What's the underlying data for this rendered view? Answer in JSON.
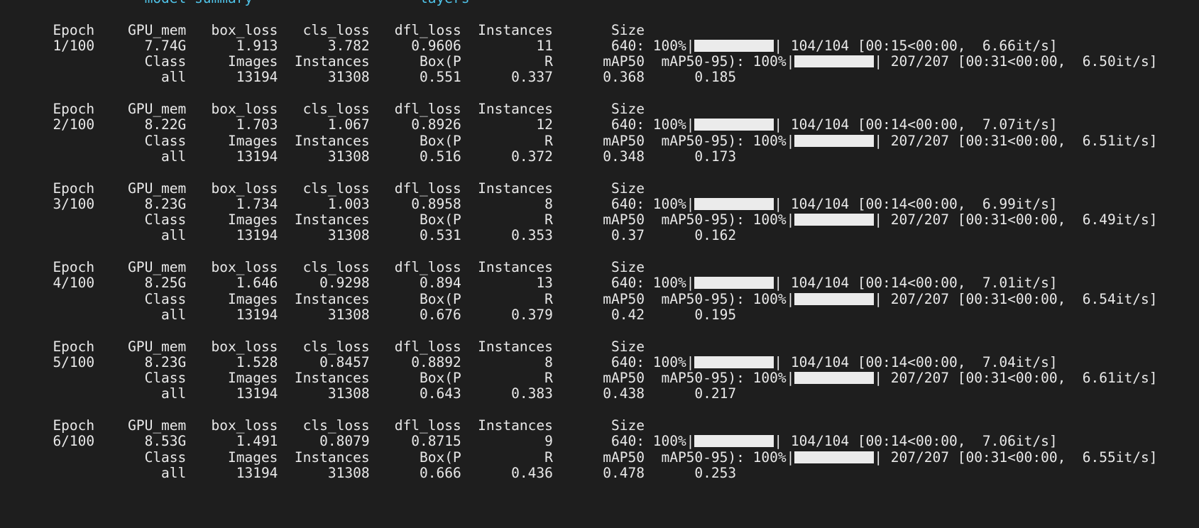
{
  "terminal": {
    "background_color": "#1e1e1e",
    "foreground_color": "#e6e6e6",
    "accent_cyan": "#4fc3e8",
    "bar_color": "#ebebeb",
    "total_epochs": "100",
    "partial_top_line": "                 model summary                    layers",
    "headers": {
      "train": "      Epoch    GPU_mem   box_loss   cls_loss   dfl_loss  Instances       Size",
      "val": "                 Class     Images  Instances      Box(P          R      mAP50  mAP50-95): "
    },
    "train_columns": [
      "Epoch",
      "GPU_mem",
      "box_loss",
      "cls_loss",
      "dfl_loss",
      "Instances",
      "Size"
    ],
    "val_columns": [
      "Class",
      "Images",
      "Instances",
      "Box(P",
      "R",
      "mAP50",
      "mAP50-95):"
    ],
    "progress": {
      "train_percent": "100%",
      "train_count": "104/104",
      "val_percent": "100%",
      "val_count": "207/207",
      "pipe": "|"
    },
    "epochs": [
      {
        "epoch": "1/100",
        "gpu_mem": "7.74G",
        "box_loss": "1.913",
        "cls_loss": "3.782",
        "dfl_loss": "0.9606",
        "instances": "11",
        "size": "640:",
        "train_percent": "100%",
        "train_count": "104/104",
        "train_elapsed": "00:15",
        "train_remaining": "00:00",
        "train_rate": "6.66it/s",
        "train_bracket": "[00:15<00:00,  6.66it/s]",
        "val_class": "all",
        "val_images": "13194",
        "val_instances": "31308",
        "box_p": "0.551",
        "recall": "0.337",
        "map50": "0.368",
        "map50_95": "0.185",
        "val_percent": "100%",
        "val_count": "207/207",
        "val_elapsed": "00:31",
        "val_remaining": "00:00",
        "val_rate": "6.50it/s",
        "val_bracket": "[00:31<00:00,  6.50it/s]"
      },
      {
        "epoch": "2/100",
        "gpu_mem": "8.22G",
        "box_loss": "1.703",
        "cls_loss": "1.067",
        "dfl_loss": "0.8926",
        "instances": "12",
        "size": "640:",
        "train_percent": "100%",
        "train_count": "104/104",
        "train_elapsed": "00:14",
        "train_remaining": "00:00",
        "train_rate": "7.07it/s",
        "train_bracket": "[00:14<00:00,  7.07it/s]",
        "val_class": "all",
        "val_images": "13194",
        "val_instances": "31308",
        "box_p": "0.516",
        "recall": "0.372",
        "map50": "0.348",
        "map50_95": "0.173",
        "val_percent": "100%",
        "val_count": "207/207",
        "val_elapsed": "00:31",
        "val_remaining": "00:00",
        "val_rate": "6.51it/s",
        "val_bracket": "[00:31<00:00,  6.51it/s]"
      },
      {
        "epoch": "3/100",
        "gpu_mem": "8.23G",
        "box_loss": "1.734",
        "cls_loss": "1.003",
        "dfl_loss": "0.8958",
        "instances": "8",
        "size": "640:",
        "train_percent": "100%",
        "train_count": "104/104",
        "train_elapsed": "00:14",
        "train_remaining": "00:00",
        "train_rate": "6.99it/s",
        "train_bracket": "[00:14<00:00,  6.99it/s]",
        "val_class": "all",
        "val_images": "13194",
        "val_instances": "31308",
        "box_p": "0.531",
        "recall": "0.353",
        "map50": "0.37",
        "map50_95": "0.162",
        "val_percent": "100%",
        "val_count": "207/207",
        "val_elapsed": "00:31",
        "val_remaining": "00:00",
        "val_rate": "6.49it/s",
        "val_bracket": "[00:31<00:00,  6.49it/s]"
      },
      {
        "epoch": "4/100",
        "gpu_mem": "8.25G",
        "box_loss": "1.646",
        "cls_loss": "0.9298",
        "dfl_loss": "0.894",
        "instances": "13",
        "size": "640:",
        "train_percent": "100%",
        "train_count": "104/104",
        "train_elapsed": "00:14",
        "train_remaining": "00:00",
        "train_rate": "7.01it/s",
        "train_bracket": "[00:14<00:00,  7.01it/s]",
        "val_class": "all",
        "val_images": "13194",
        "val_instances": "31308",
        "box_p": "0.676",
        "recall": "0.379",
        "map50": "0.42",
        "map50_95": "0.195",
        "val_percent": "100%",
        "val_count": "207/207",
        "val_elapsed": "00:31",
        "val_remaining": "00:00",
        "val_rate": "6.54it/s",
        "val_bracket": "[00:31<00:00,  6.54it/s]"
      },
      {
        "epoch": "5/100",
        "gpu_mem": "8.23G",
        "box_loss": "1.528",
        "cls_loss": "0.8457",
        "dfl_loss": "0.8892",
        "instances": "8",
        "size": "640:",
        "train_percent": "100%",
        "train_count": "104/104",
        "train_elapsed": "00:14",
        "train_remaining": "00:00",
        "train_rate": "7.04it/s",
        "train_bracket": "[00:14<00:00,  7.04it/s]",
        "val_class": "all",
        "val_images": "13194",
        "val_instances": "31308",
        "box_p": "0.643",
        "recall": "0.383",
        "map50": "0.438",
        "map50_95": "0.217",
        "val_percent": "100%",
        "val_count": "207/207",
        "val_elapsed": "00:31",
        "val_remaining": "00:00",
        "val_rate": "6.61it/s",
        "val_bracket": "[00:31<00:00,  6.61it/s]"
      },
      {
        "epoch": "6/100",
        "gpu_mem": "8.53G",
        "box_loss": "1.491",
        "cls_loss": "0.8079",
        "dfl_loss": "0.8715",
        "instances": "9",
        "size": "640:",
        "train_percent": "100%",
        "train_count": "104/104",
        "train_elapsed": "00:14",
        "train_remaining": "00:00",
        "train_rate": "7.06it/s",
        "train_bracket": "[00:14<00:00,  7.06it/s]",
        "val_class": "all",
        "val_images": "13194",
        "val_instances": "31308",
        "box_p": "0.666",
        "recall": "0.436",
        "map50": "0.478",
        "map50_95": "0.253",
        "val_percent": "100%",
        "val_count": "207/207",
        "val_elapsed": "00:31",
        "val_remaining": "00:00",
        "val_rate": "6.55it/s",
        "val_bracket": "[00:31<00:00,  6.55it/s]"
      }
    ]
  }
}
